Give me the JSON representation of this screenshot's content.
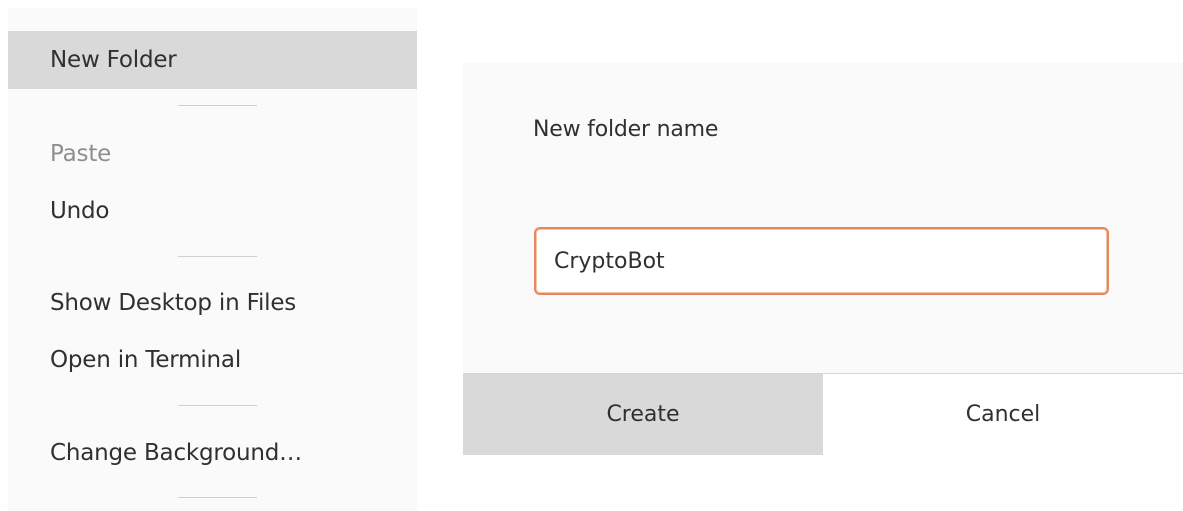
{
  "context_menu": {
    "items": [
      {
        "label": "New Folder",
        "state": "highlighted"
      },
      {
        "label": "Paste",
        "state": "disabled"
      },
      {
        "label": "Undo",
        "state": "normal"
      },
      {
        "label": "Show Desktop in Files",
        "state": "normal"
      },
      {
        "label": "Open in Terminal",
        "state": "normal"
      },
      {
        "label": "Change Background…",
        "state": "normal"
      }
    ]
  },
  "dialog": {
    "label": "New folder name",
    "input_value": "CryptoBot",
    "create_label": "Create",
    "cancel_label": "Cancel"
  },
  "colors": {
    "highlight": "#d9d9d9",
    "focus_border": "#e8865e",
    "disabled_text": "#8e8e8e"
  }
}
